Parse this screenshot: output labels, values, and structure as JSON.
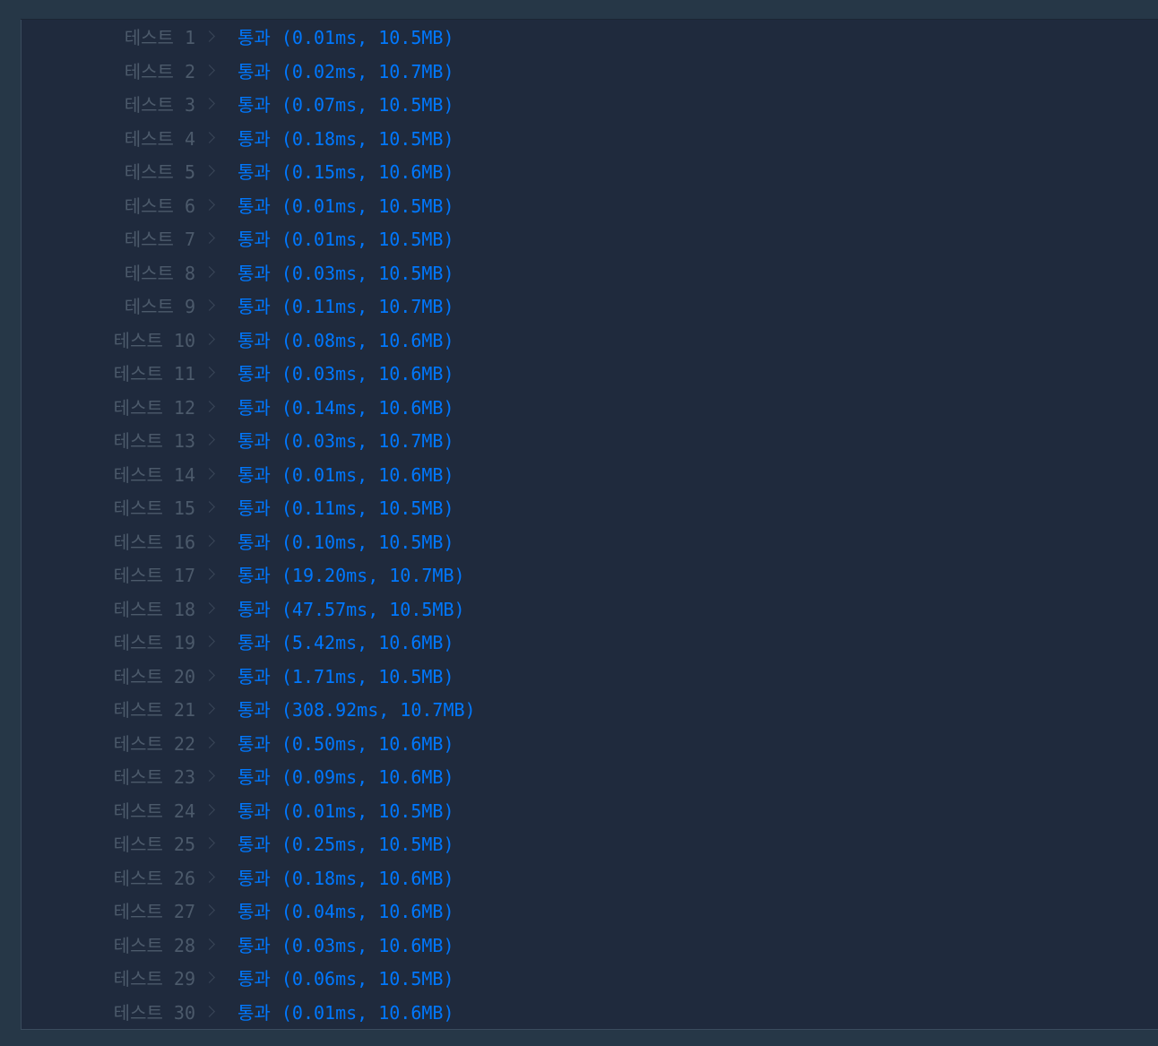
{
  "results": [
    {
      "label": "테스트 1",
      "status": "통과",
      "detail": "(0.01ms, 10.5MB)"
    },
    {
      "label": "테스트 2",
      "status": "통과",
      "detail": "(0.02ms, 10.7MB)"
    },
    {
      "label": "테스트 3",
      "status": "통과",
      "detail": "(0.07ms, 10.5MB)"
    },
    {
      "label": "테스트 4",
      "status": "통과",
      "detail": "(0.18ms, 10.5MB)"
    },
    {
      "label": "테스트 5",
      "status": "통과",
      "detail": "(0.15ms, 10.6MB)"
    },
    {
      "label": "테스트 6",
      "status": "통과",
      "detail": "(0.01ms, 10.5MB)"
    },
    {
      "label": "테스트 7",
      "status": "통과",
      "detail": "(0.01ms, 10.5MB)"
    },
    {
      "label": "테스트 8",
      "status": "통과",
      "detail": "(0.03ms, 10.5MB)"
    },
    {
      "label": "테스트 9",
      "status": "통과",
      "detail": "(0.11ms, 10.7MB)"
    },
    {
      "label": "테스트 10",
      "status": "통과",
      "detail": "(0.08ms, 10.6MB)"
    },
    {
      "label": "테스트 11",
      "status": "통과",
      "detail": "(0.03ms, 10.6MB)"
    },
    {
      "label": "테스트 12",
      "status": "통과",
      "detail": "(0.14ms, 10.6MB)"
    },
    {
      "label": "테스트 13",
      "status": "통과",
      "detail": "(0.03ms, 10.7MB)"
    },
    {
      "label": "테스트 14",
      "status": "통과",
      "detail": "(0.01ms, 10.6MB)"
    },
    {
      "label": "테스트 15",
      "status": "통과",
      "detail": "(0.11ms, 10.5MB)"
    },
    {
      "label": "테스트 16",
      "status": "통과",
      "detail": "(0.10ms, 10.5MB)"
    },
    {
      "label": "테스트 17",
      "status": "통과",
      "detail": "(19.20ms, 10.7MB)"
    },
    {
      "label": "테스트 18",
      "status": "통과",
      "detail": "(47.57ms, 10.5MB)"
    },
    {
      "label": "테스트 19",
      "status": "통과",
      "detail": "(5.42ms, 10.6MB)"
    },
    {
      "label": "테스트 20",
      "status": "통과",
      "detail": "(1.71ms, 10.5MB)"
    },
    {
      "label": "테스트 21",
      "status": "통과",
      "detail": "(308.92ms, 10.7MB)"
    },
    {
      "label": "테스트 22",
      "status": "통과",
      "detail": "(0.50ms, 10.6MB)"
    },
    {
      "label": "테스트 23",
      "status": "통과",
      "detail": "(0.09ms, 10.6MB)"
    },
    {
      "label": "테스트 24",
      "status": "통과",
      "detail": "(0.01ms, 10.5MB)"
    },
    {
      "label": "테스트 25",
      "status": "통과",
      "detail": "(0.25ms, 10.5MB)"
    },
    {
      "label": "테스트 26",
      "status": "통과",
      "detail": "(0.18ms, 10.6MB)"
    },
    {
      "label": "테스트 27",
      "status": "통과",
      "detail": "(0.04ms, 10.6MB)"
    },
    {
      "label": "테스트 28",
      "status": "통과",
      "detail": "(0.03ms, 10.6MB)"
    },
    {
      "label": "테스트 29",
      "status": "통과",
      "detail": "(0.06ms, 10.5MB)"
    },
    {
      "label": "테스트 30",
      "status": "통과",
      "detail": "(0.01ms, 10.6MB)"
    }
  ],
  "colors": {
    "label": "#4c5a6b",
    "pass": "#0078ff",
    "panel": "#1f2a3d",
    "frame": "#263747"
  }
}
